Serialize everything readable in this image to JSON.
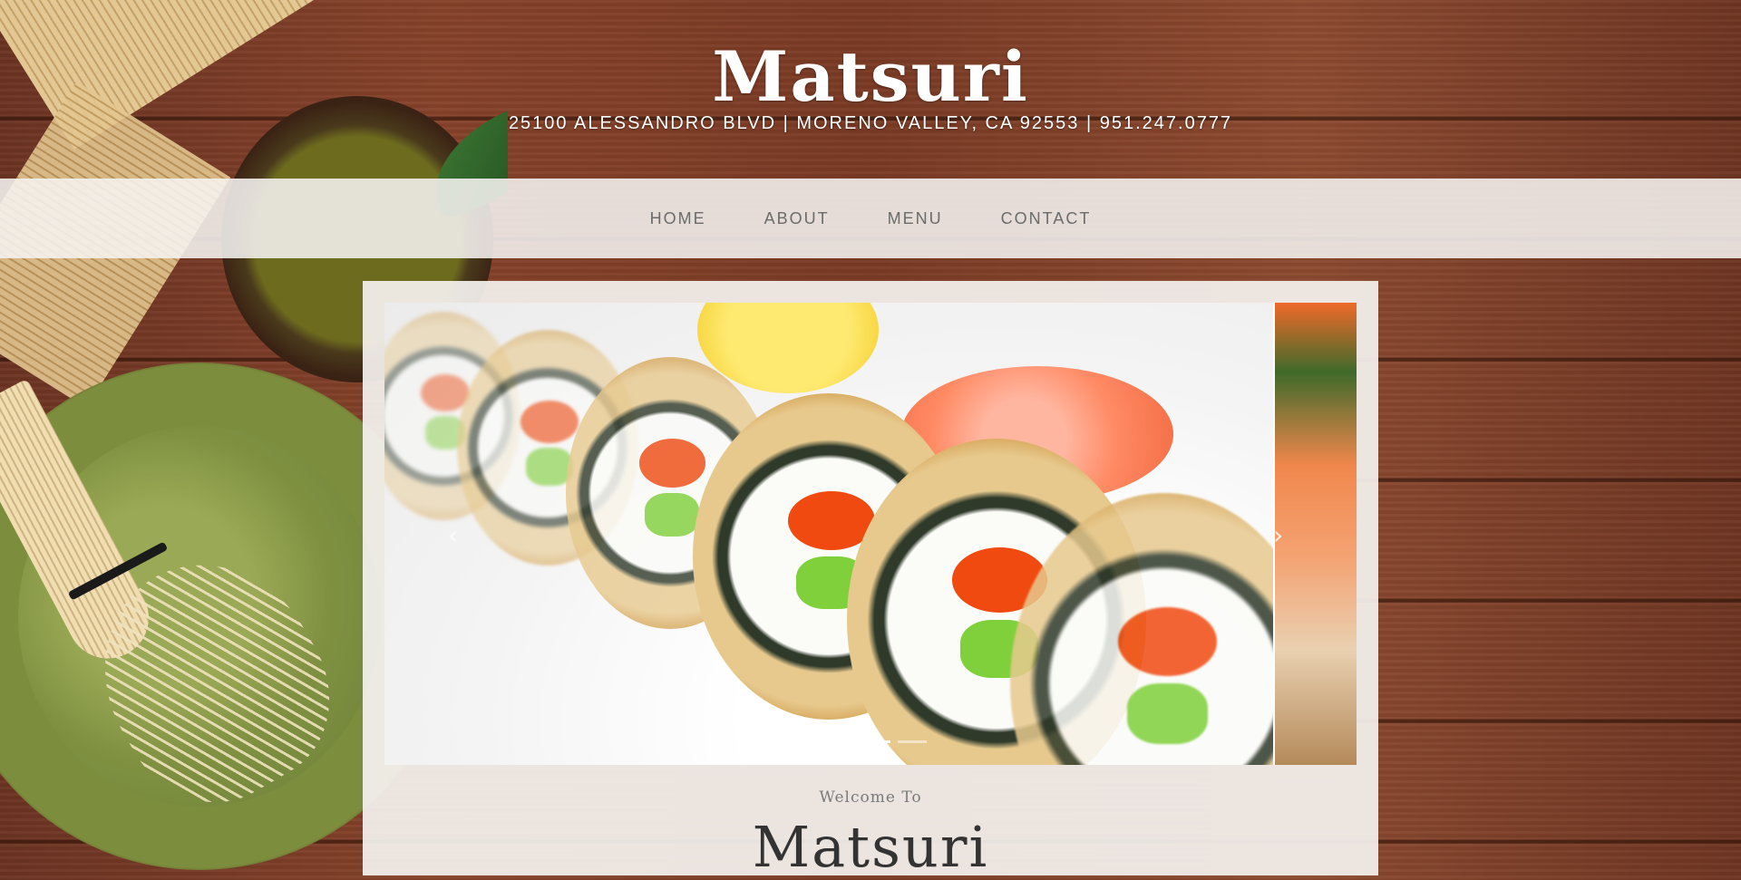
{
  "header": {
    "brand": "Matsuri",
    "address": "25100 ALESSANDRO BLVD | MORENO VALLEY, CA 92553 | 951.247.0777"
  },
  "nav": {
    "items": [
      {
        "label": "HOME"
      },
      {
        "label": "ABOUT"
      },
      {
        "label": "MENU"
      },
      {
        "label": "CONTACT"
      }
    ]
  },
  "slider": {
    "prev_icon": "chevron-left-icon",
    "next_icon": "chevron-right-icon",
    "prev_glyph": "‹",
    "next_glyph": "›",
    "slide_count": 3,
    "active_slide": 2
  },
  "welcome": {
    "intro": "Welcome To",
    "title": "Matsuri"
  },
  "colors": {
    "wood": "#7a3a24",
    "nav_bg": "#f5f3f0",
    "nav_text": "#6b6b6b",
    "panel_bg": "#f4f1ee"
  }
}
